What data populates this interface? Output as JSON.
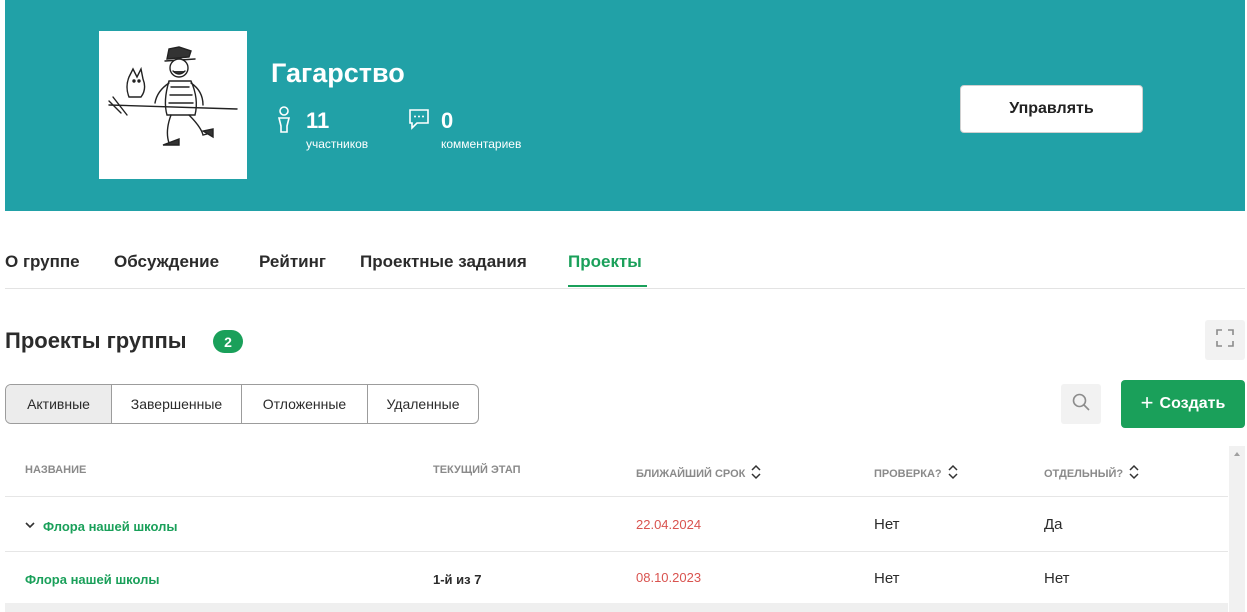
{
  "group": {
    "title": "Гагарство",
    "members_count": "11",
    "members_label": "участников",
    "comments_count": "0",
    "comments_label": "комментариев",
    "manage_label": "Управлять"
  },
  "tabs": [
    {
      "label": "О группе",
      "active": false
    },
    {
      "label": "Обсуждение",
      "active": false
    },
    {
      "label": "Рейтинг",
      "active": false
    },
    {
      "label": "Проектные задания",
      "active": false
    },
    {
      "label": "Проекты",
      "active": true
    }
  ],
  "section": {
    "title": "Проекты группы",
    "count": "2"
  },
  "filters": [
    {
      "label": "Активные",
      "active": true
    },
    {
      "label": "Завершенные",
      "active": false
    },
    {
      "label": "Отложенные",
      "active": false
    },
    {
      "label": "Удаленные",
      "active": false
    }
  ],
  "create_label": "Создать",
  "table": {
    "headers": {
      "name": "НАЗВАНИЕ",
      "stage": "ТЕКУЩИЙ ЭТАП",
      "deadline": "БЛИЖАЙШИЙ СРОК",
      "review": "ПРОВЕРКА?",
      "separate": "ОТДЕЛЬНЫЙ?"
    },
    "rows": [
      {
        "name": "Флора нашей школы",
        "stage": "",
        "deadline": "22.04.2024",
        "review": "Нет",
        "separate": "Да",
        "expandable": true
      },
      {
        "name": "Флора нашей школы",
        "stage": "1-й из 7",
        "deadline": "08.10.2023",
        "review": "Нет",
        "separate": "Нет",
        "expandable": false
      }
    ]
  },
  "colors": {
    "banner": "#21a1a7",
    "accent_green": "#1aa05a",
    "date_red": "#d9534f"
  },
  "icons": [
    "person-icon",
    "comment-icon",
    "fullscreen-icon",
    "search-icon",
    "plus-icon",
    "sort-icon",
    "chevron-down-icon"
  ]
}
